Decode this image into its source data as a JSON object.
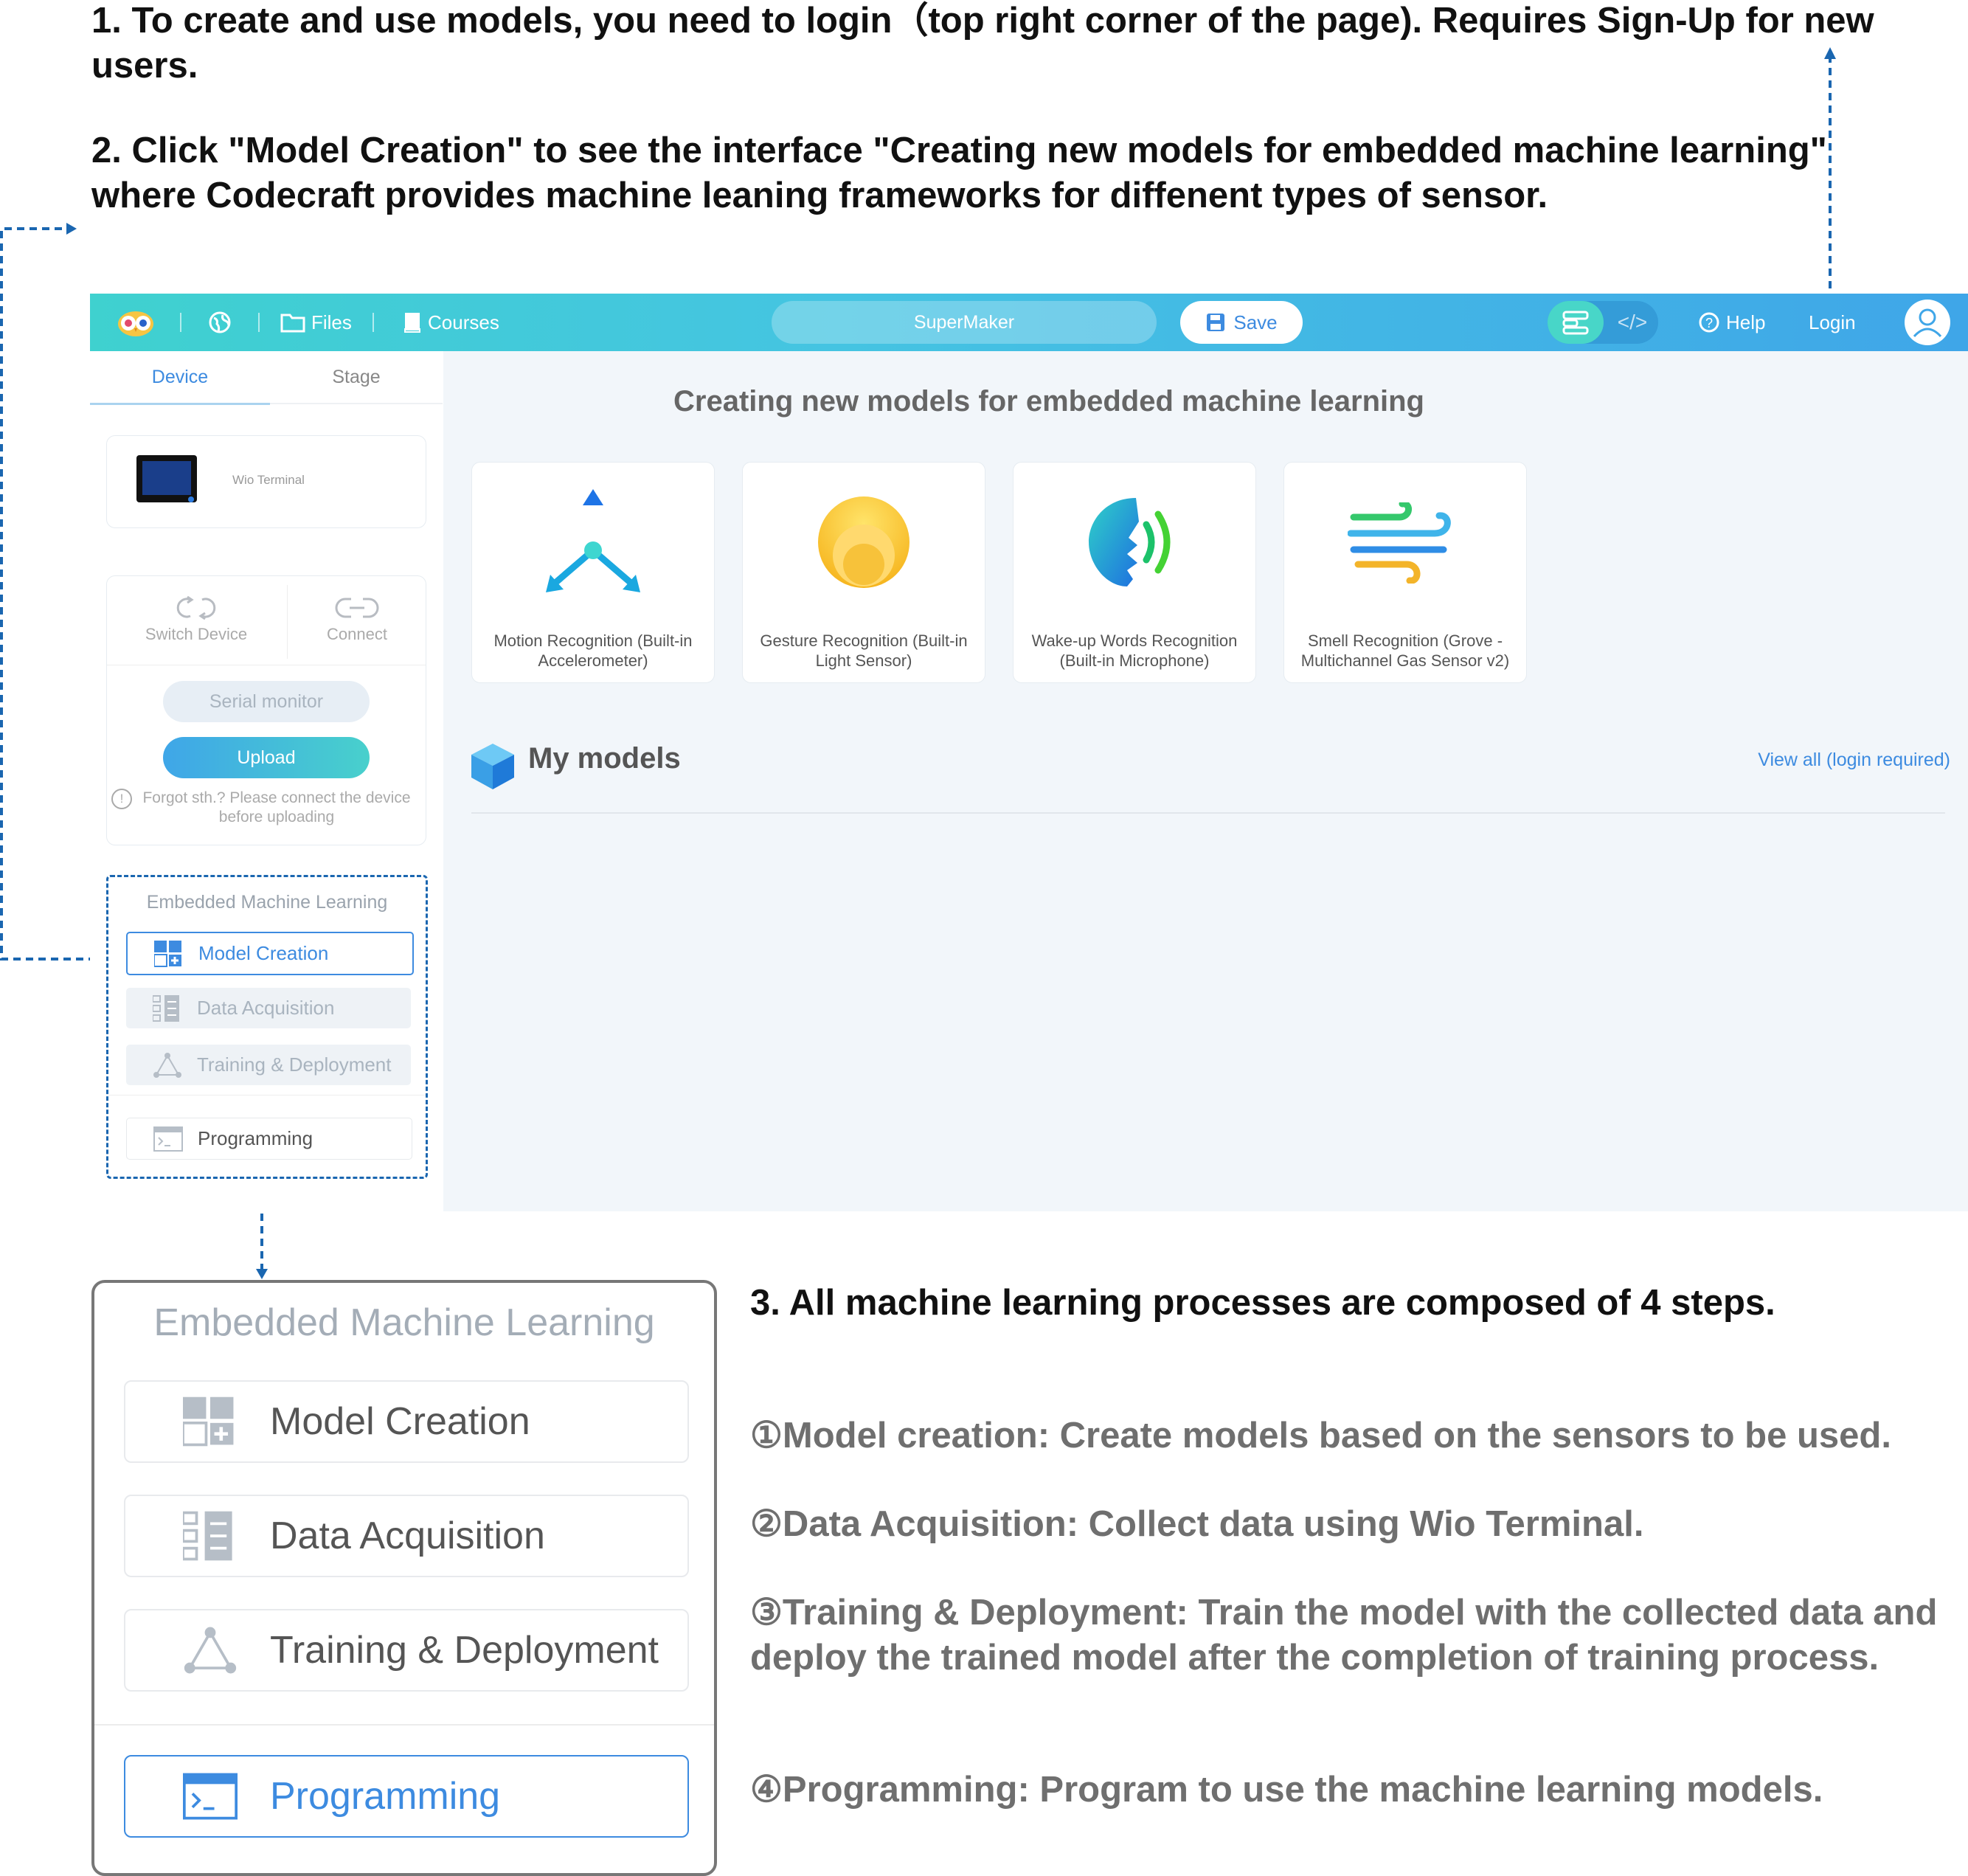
{
  "instructions": {
    "step1": "1. To create and use models, you need to login（top right corner of the page). Requires Sign-Up for new users.",
    "step2": "2. Click \"Model Creation\" to see the interface \"Creating new models for embedded machine learning\" where Codecraft provides machine leaning frameworks for diffenent types of sensor.",
    "step3": "3. All machine learning processes are composed of 4 steps.",
    "details": [
      "①Model creation: Create models based on the sensors to be used.",
      "②Data Acquisition: Collect data using Wio Terminal.",
      "③Training & Deployment: Train the model with the collected data and deploy the trained model after the completion of training process.",
      "④Programming: Program to use the machine learning models."
    ]
  },
  "topbar": {
    "files": "Files",
    "courses": "Courses",
    "project_name": "SuperMaker",
    "save": "Save",
    "help": "Help",
    "login": "Login",
    "code_toggle_icon": "</>"
  },
  "sidebar": {
    "tabs": [
      "Device",
      "Stage"
    ],
    "device_name": "Wio Terminal",
    "switch_device": "Switch Device",
    "connect": "Connect",
    "serial_monitor": "Serial monitor",
    "upload": "Upload",
    "upload_hint": "Forgot sth.? Please connect the device before uploading",
    "eml_title": "Embedded Machine Learning",
    "menu": [
      "Model Creation",
      "Data Acquisition",
      "Training & Deployment",
      "Programming"
    ]
  },
  "main": {
    "title": "Creating new models for embedded machine learning",
    "models": [
      "Motion Recognition (Built-in Accelerometer)",
      "Gesture Recognition (Built-in Light Sensor)",
      "Wake-up Words Recognition (Built-in Microphone)",
      "Smell Recognition (Grove - Multichannel Gas Sensor v2)"
    ],
    "my_models": "My models",
    "view_all": "View all (login required)"
  },
  "zoom_panel": {
    "title": "Embedded Machine Learning",
    "menu": [
      "Model Creation",
      "Data Acquisition",
      "Training & Deployment",
      "Programming"
    ]
  },
  "colors": {
    "accent_blue": "#3d8be0",
    "header_start": "#3fd1cf",
    "header_end": "#3fa6e8",
    "annotation_dash": "#1a66b0"
  }
}
